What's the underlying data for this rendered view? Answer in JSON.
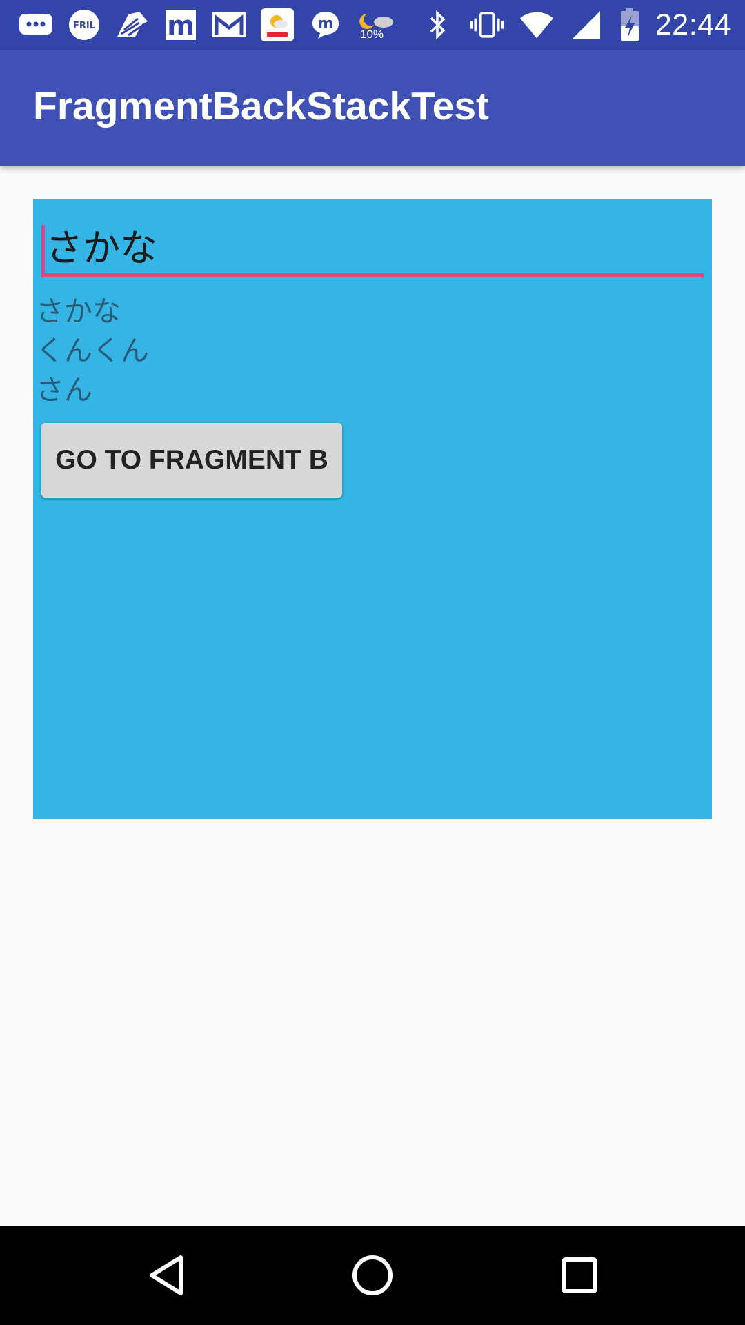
{
  "status_bar": {
    "time": "22:44",
    "weather_percent": "10%",
    "left_icons": [
      "messages-icon",
      "fril-icon",
      "zebra-icon",
      "m-app-icon",
      "gmail-icon",
      "yahoo-weather-icon",
      "m-chat-icon",
      "weather-night-cloud-icon"
    ],
    "right_icons": [
      "bluetooth-icon",
      "vibrate-icon",
      "wifi-icon",
      "signal-icon",
      "battery-charging-icon"
    ]
  },
  "app_bar": {
    "title": "FragmentBackStackTest",
    "color": "#3f51b5"
  },
  "fragment": {
    "background": "#35b5e5",
    "edit_text_value": "さかな",
    "accent_color": "#e4457d",
    "lines": [
      "さかな",
      "くんくん",
      "さん"
    ],
    "button_label": "GO TO FRAGMENT B"
  },
  "nav_bar": {
    "buttons": [
      "back-icon",
      "home-icon",
      "recents-icon"
    ]
  }
}
